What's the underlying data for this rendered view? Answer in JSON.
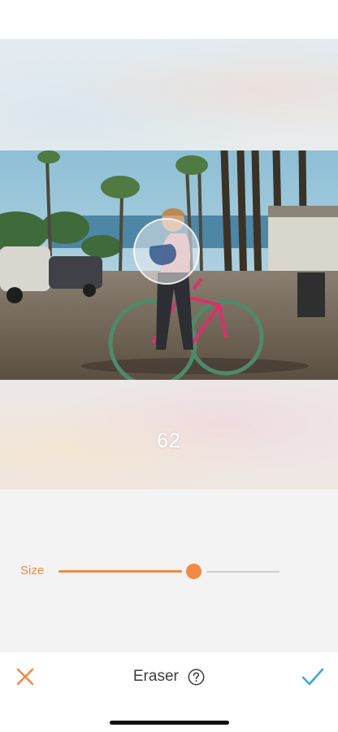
{
  "brush_size_display": "62",
  "size_control": {
    "label": "Size",
    "value_fraction": 0.62
  },
  "toolbar": {
    "title": "Eraser",
    "cancel_icon": "close-x-icon",
    "help_icon": "help-circle-icon",
    "confirm_icon": "checkmark-icon"
  },
  "colors": {
    "accent_orange": "#f08a45",
    "confirm_blue": "#3aa8dc"
  }
}
